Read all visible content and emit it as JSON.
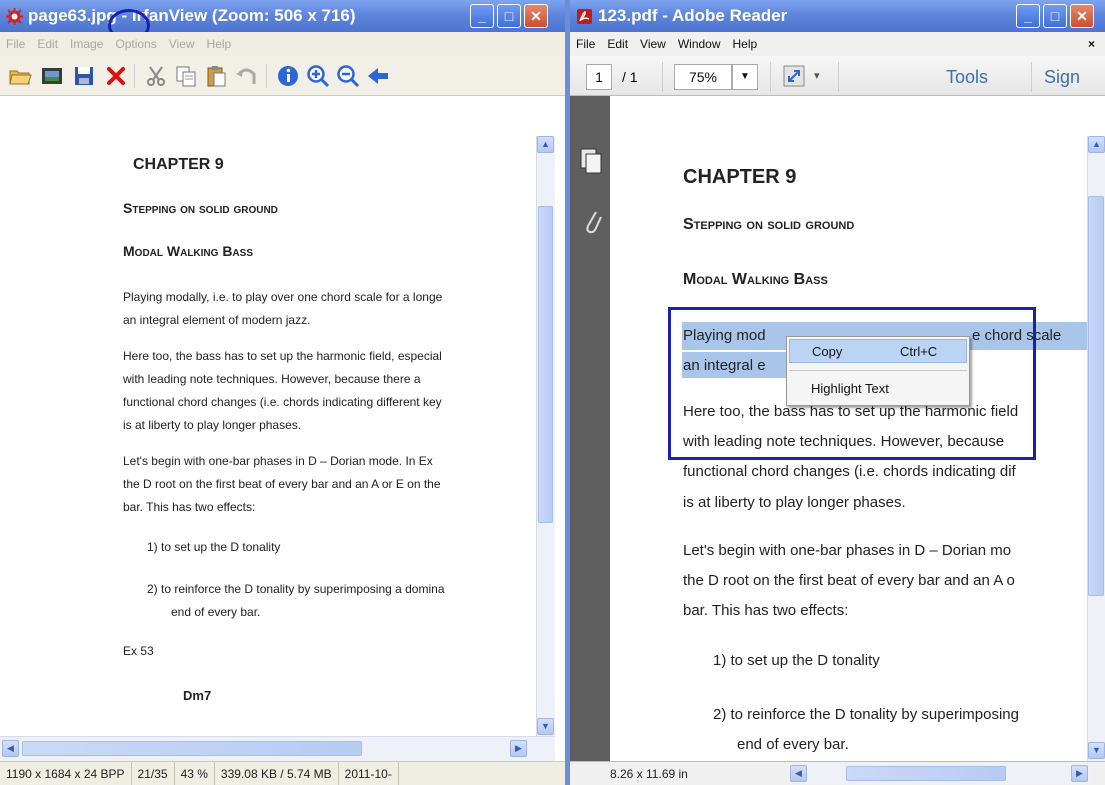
{
  "irfanview": {
    "title_prefix": "page63",
    "title_ext": "jpg",
    "title_suffix": " - IrfanView (Zoom: 506 x 716)",
    "menu": [
      "File",
      "Edit",
      "Image",
      "Options",
      "View",
      "Help"
    ],
    "status": {
      "dims": "1190 x 1684 x 24 BPP",
      "index": "21/35",
      "zoom": "43 %",
      "size": "339.08 KB / 5.74 MB",
      "date": "2011-10-"
    },
    "page": {
      "chapter": "CHAPTER 9",
      "subtitle": "Stepping on solid ground",
      "section": "Modal Walking Bass",
      "lines": [
        "Playing modally, i.e. to play over one chord scale for a longe",
        "an integral element of modern jazz.",
        "Here too, the bass has to set up the harmonic field, especial",
        "with leading note techniques. However, because there a",
        "functional chord changes (i.e. chords indicating different key",
        "is at liberty to play longer phases.",
        "Let's begin with one-bar phases in D – Dorian mode. In Ex",
        "the D root on the first beat of every bar and an A or E on the",
        "bar. This has two effects:",
        "1)  to set up the D tonality",
        "2)  to reinforce the D tonality by superimposing a domina",
        "end of every bar.",
        "Ex 53",
        "Dm7"
      ]
    }
  },
  "reader": {
    "title": "123.pdf - Adobe Reader",
    "menu": [
      "File",
      "Edit",
      "View",
      "Window",
      "Help"
    ],
    "menu_close": "×",
    "page_current": "1",
    "page_total": "/ 1",
    "zoom": "75%",
    "tools_label": "Tools",
    "sign_label": "Sign",
    "page_size": "8.26 x 11.69 in",
    "page": {
      "chapter": "CHAPTER 9",
      "subtitle": "Stepping on solid ground",
      "section": "Modal Walking Bass",
      "lines": [
        "Playing mod",
        "e chord scale",
        "an integral e",
        "Here too, the bass has to set up the harmonic field",
        "with leading note techniques. However, because",
        "functional chord changes (i.e. chords indicating dif",
        "is at liberty to play longer phases.",
        "Let's begin with one-bar phases in D – Dorian mo",
        "the D root on the first beat of every bar and an A o",
        "bar. This has two effects:",
        "1)  to set up the D tonality",
        "2)  to reinforce the D tonality by superimposing",
        "end of every bar."
      ]
    },
    "context_menu": {
      "copy": "Copy",
      "copy_shortcut": "Ctrl+C",
      "highlight": "Highlight Text"
    }
  },
  "colors": {
    "annotation": "#1a20b0",
    "selection": "#a9c6ea",
    "titlebar": "#5f86dd"
  }
}
